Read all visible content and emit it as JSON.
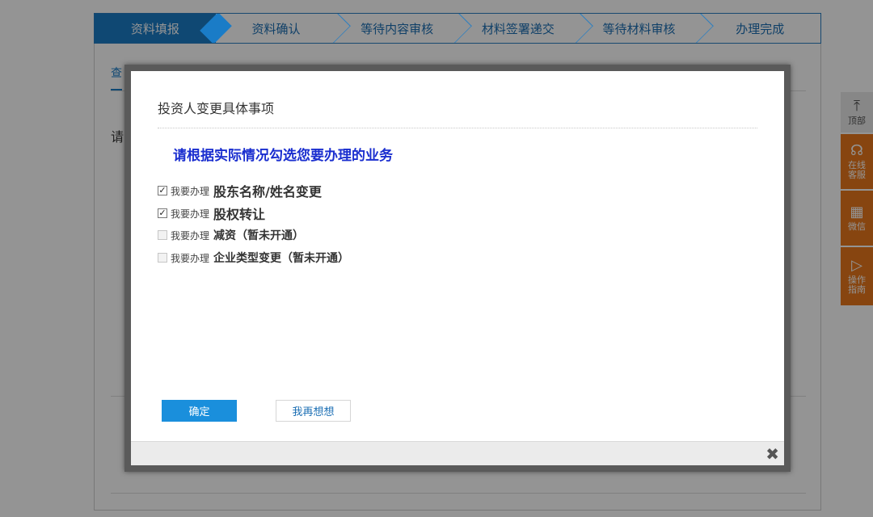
{
  "steps": [
    "资料填报",
    "资料确认",
    "等待内容审核",
    "材料签署递交",
    "等待材料审核",
    "办理完成"
  ],
  "background": {
    "tab_label": "查",
    "prompt_text": "请"
  },
  "footer_links": [
    "...",
    "...",
    "...",
    "...",
    "..."
  ],
  "side_tools": {
    "top_label": "顶部",
    "top_icon": "arrow-up-icon",
    "kefu_label": "在线客服",
    "kefu_icon": "headset-icon",
    "wx_label": "微信",
    "wx_icon": "qrcode-icon",
    "guide_label": "操作指南",
    "guide_icon": "play-circle-icon"
  },
  "modal": {
    "title": "投资人变更具体事项",
    "heading": "请根据实际情况勾选您要办理的业务",
    "options": [
      {
        "prefix": "我要办理",
        "label": "股东名称/姓名变更",
        "checked": true,
        "disabled": false
      },
      {
        "prefix": "我要办理",
        "label": "股权转让",
        "checked": true,
        "disabled": false
      },
      {
        "prefix": "我要办理",
        "label": "减资（暂未开通）",
        "checked": false,
        "disabled": true
      },
      {
        "prefix": "我要办理",
        "label": "企业类型变更（暂未开通）",
        "checked": false,
        "disabled": true
      }
    ],
    "ok_label": "确定",
    "cancel_label": "我再想想",
    "close_glyph": "✖"
  },
  "colors": {
    "accent_blue": "#1a7cc7",
    "heading_blue": "#1a2ecf",
    "side_orange": "#e8781c",
    "ok_button": "#1a8fdc"
  }
}
